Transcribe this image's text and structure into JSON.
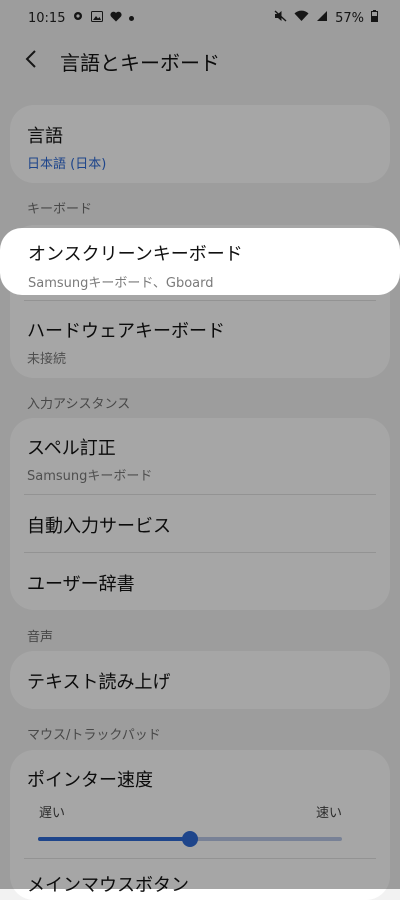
{
  "status": {
    "time": "10:15",
    "battery": "57%"
  },
  "header": {
    "title": "言語とキーボード"
  },
  "language": {
    "label": "言語",
    "value": "日本語 (日本)"
  },
  "sections": {
    "keyboard": "キーボード",
    "input_assist": "入力アシスタンス",
    "voice": "音声",
    "mouse": "マウス/トラックパッド"
  },
  "onscreen_keyboard": {
    "label": "オンスクリーンキーボード",
    "sub": "Samsungキーボード、Gboard"
  },
  "hardware_keyboard": {
    "label": "ハードウェアキーボード",
    "sub": "未接続"
  },
  "spell_check": {
    "label": "スペル訂正",
    "sub": "Samsungキーボード"
  },
  "autofill": {
    "label": "自動入力サービス"
  },
  "user_dictionary": {
    "label": "ユーザー辞書"
  },
  "tts": {
    "label": "テキスト読み上げ"
  },
  "pointer_speed": {
    "label": "ポインター速度",
    "slow": "遅い",
    "fast": "速い",
    "value": 0.5
  },
  "main_mouse_button": {
    "label": "メインマウスボタン"
  },
  "colors": {
    "accent": "#2f6bd6"
  }
}
